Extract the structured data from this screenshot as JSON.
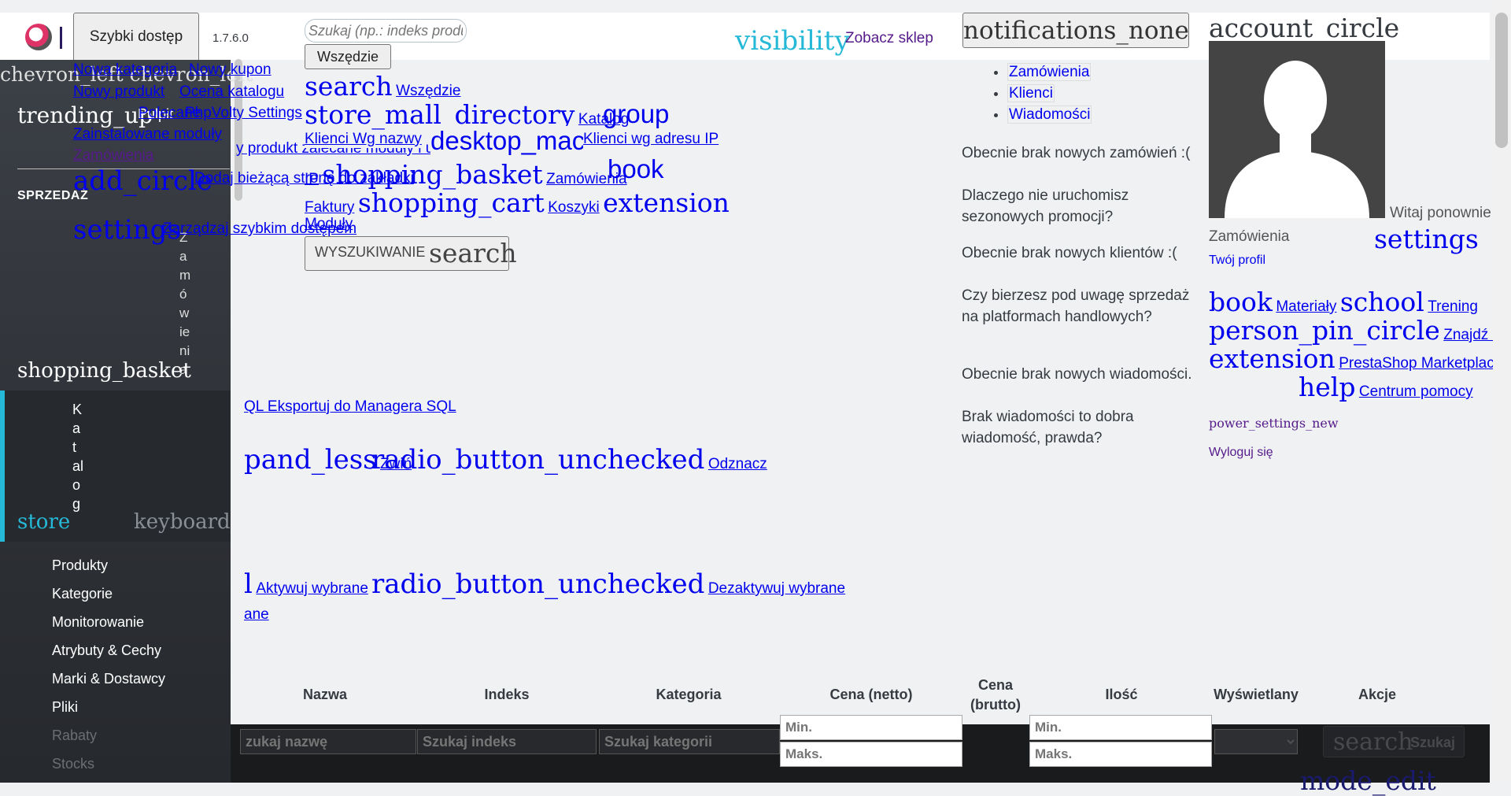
{
  "header": {
    "quick_access_label": "Szybki dostęp",
    "version": "1.7.6.0",
    "search_placeholder": "Szukaj (np.: indeks produktu",
    "search_scope_label": "Wszędzie",
    "visibility_icon": "visibility",
    "shop_link": "Zobacz sklep",
    "notifications_icon": "notifications_none",
    "account_icon": "account_circle"
  },
  "quick_access_menu": [
    "Nowa kategoria",
    "Nowy kupon",
    "Nowy produkt",
    "Ocena katalogu",
    "Polecane",
    "PhpVolty Settings",
    "Zainstalowane moduły",
    "Zamówienia"
  ],
  "quick_access_actions": {
    "add_icon": "add_circle",
    "add_label": "Dodaj bieżącą stronę do zakładki",
    "manage_icon": "settings",
    "manage_label": "Zarządzaj szybkim dostępem"
  },
  "search_scopes": {
    "everywhere_icon": "search",
    "everywhere": "Wszędzie",
    "catalog_icon": "store_mall_directory",
    "catalog": "Katalog",
    "group_icon": "group",
    "customers_by_name": "Klienci Wg nazwy",
    "desktop_icon": "desktop_mac",
    "customers_by_ip": "Klienci wg adresu IP",
    "basket_icon": "shopping_basket",
    "orders": "Zamówienia",
    "book_icon": "book",
    "invoices": "Faktury",
    "cart_icon": "shopping_cart",
    "carts": "Koszyki",
    "extension_icon": "extension",
    "modules": "Moduły",
    "search_button_label": "WYSZUKIWANIE",
    "search_button_icon": "search",
    "overlap_text": "y produkt zalecane moduły i usługi Pomoc"
  },
  "sidebar": {
    "collapse_icons": "chevron_left chevron_left",
    "dashboard_icon": "trending_up",
    "dashboard_label": "Pulpit",
    "section_sales": "SPRZEDAŻ",
    "orders_label": "Zamówienia",
    "basket_icon": "shopping_basket",
    "catalog_label": "Katalog",
    "store_icon": "store",
    "arrow_icon": "keyboard_arrow_down",
    "catalog_submenu": [
      "Produkty",
      "Kategorie",
      "Monitorowanie",
      "Atrybuty & Cechy",
      "Marki & Dostawcy",
      "Pliki",
      "Rabaty",
      "Stocks"
    ]
  },
  "notifications": {
    "tabs": [
      "Zamówienia",
      "Klienci",
      "Wiadomości"
    ],
    "orders_empty": "Obecnie brak nowych zamówień :(",
    "orders_hint": "Dlaczego nie uruchomisz sezonowych promocji?",
    "customers_empty": "Obecnie brak nowych klientów :(",
    "customers_hint": "Czy bierzesz pod uwagę sprzedaż na platformach handlowych?",
    "messages_empty": "Obecnie brak nowych wiadomości.",
    "messages_hint": "Brak wiadomości to dobra wiadomość, prawda?"
  },
  "account": {
    "welcome": "Witaj ponownie Zamówienia",
    "settings_icon": "settings",
    "profile_link": "Twój profil",
    "book_icon": "book",
    "resources": "Materiały",
    "school_icon": "school",
    "training": "Trening",
    "expert_icon": "person_pin_circle",
    "find_expert": "Znajdź eksperta",
    "extension_icon": "extension",
    "marketplace": "PrestaShop Marketplace",
    "help_icon": "help",
    "help_center": "Centrum pomocy",
    "logout_icon": "power_settings_new",
    "logout": "Wyloguj się"
  },
  "main": {
    "sql_export": "QL Eksportuj do Managera SQL",
    "expand_icon": "pand_less",
    "collapse_label": "Zwiń",
    "radio_icon": "radio_button_unchecked",
    "uncheck_label": "Odznacz",
    "bulk_icon_fragment": "l",
    "activate_label": "Aktywuj wybrane",
    "deactivate_label": "Dezaktywuj wybrane",
    "delete_fragment": "ane"
  },
  "table": {
    "columns": [
      "Nazwa",
      "Indeks",
      "Kategoria",
      "Cena (netto)",
      "Cena (brutto)",
      "Ilość",
      "Wyświetlany",
      "Akcje"
    ],
    "filter_name": "zukaj nazwę",
    "filter_index": "Szukaj indeks",
    "filter_category": "Szukaj kategorii",
    "min": "Min.",
    "max": "Maks.",
    "search_icon": "search",
    "search_label": "Szukaj",
    "overflow_text": "mode_edit"
  }
}
